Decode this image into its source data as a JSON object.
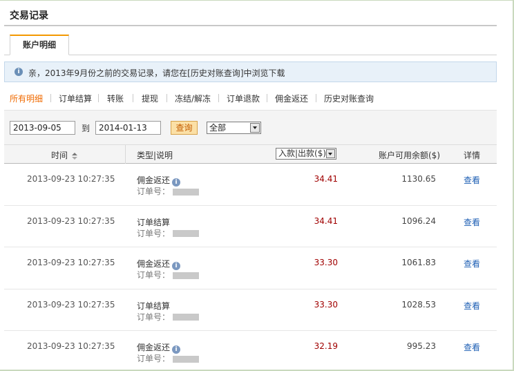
{
  "page": {
    "title": "交易记录"
  },
  "tabs": {
    "active_label": "账户明细"
  },
  "notice": {
    "text": "亲，2013年9月份之前的交易记录，请您在[历史对账查询]中浏览下载"
  },
  "filters": [
    {
      "label": "所有明细",
      "active": true
    },
    {
      "label": "订单结算",
      "active": false
    },
    {
      "label": "转账",
      "active": false
    },
    {
      "label": "提现",
      "active": false
    },
    {
      "label": "冻结/解冻",
      "active": false
    },
    {
      "label": "订单退款",
      "active": false
    },
    {
      "label": "佣金返还",
      "active": false
    },
    {
      "label": "历史对账查询",
      "active": false
    }
  ],
  "search": {
    "start_date": "2013-09-05",
    "to_label": "到",
    "end_date": "2014-01-13",
    "query_label": "查询",
    "type_selected": "全部"
  },
  "table": {
    "headers": {
      "time": "时间",
      "type": "类型|说明",
      "inout": "入款|出款($)",
      "balance": "账户可用余额($)",
      "detail": "详情"
    },
    "order_prefix": "订单号：",
    "view_label": "查看",
    "rows": [
      {
        "time": "2013-09-23 10:27:35",
        "type": "佣金返还",
        "has_info": true,
        "amount": "34.41",
        "balance": "1130.65"
      },
      {
        "time": "2013-09-23 10:27:35",
        "type": "订单结算",
        "has_info": false,
        "amount": "34.41",
        "balance": "1096.24"
      },
      {
        "time": "2013-09-23 10:27:35",
        "type": "佣金返还",
        "has_info": true,
        "amount": "33.30",
        "balance": "1061.83"
      },
      {
        "time": "2013-09-23 10:27:35",
        "type": "订单结算",
        "has_info": false,
        "amount": "33.30",
        "balance": "1028.53"
      },
      {
        "time": "2013-09-23 10:27:35",
        "type": "佣金返还",
        "has_info": true,
        "amount": "32.19",
        "balance": "995.23"
      }
    ]
  },
  "colors": {
    "accent": "#f06a00",
    "amount": "#a00000",
    "link": "#1e5fb4",
    "notice_bg": "#e8f1f9"
  },
  "icons": {
    "notice": "info-circle-icon",
    "sort": "sort-icon",
    "row_info": "info-circle-icon"
  }
}
